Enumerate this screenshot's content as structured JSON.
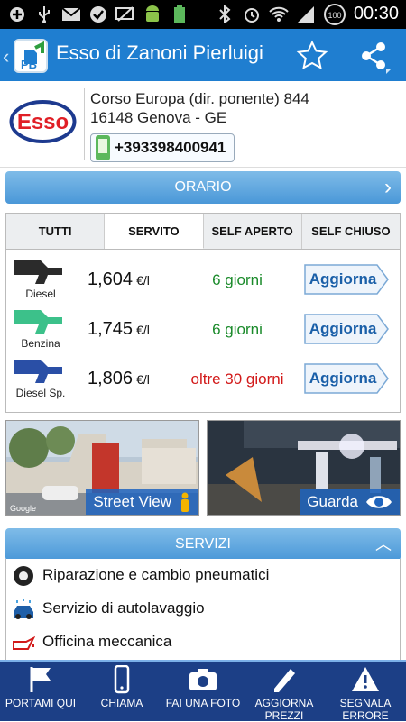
{
  "status_bar": {
    "time": "00:30",
    "battery": "100",
    "left_icons": [
      "plus-icon",
      "usb-icon",
      "gmail-icon",
      "check-icon",
      "mail-off-icon",
      "android-icon",
      "battery-small-icon"
    ],
    "right_icons": [
      "bluetooth-icon",
      "alarm-icon",
      "wifi-icon",
      "signal-icon",
      "battery-icon"
    ]
  },
  "app_bar": {
    "title": "Esso di Zanoni Pierluigi",
    "icons": [
      "back-icon",
      "app-logo-icon",
      "star-icon",
      "share-icon"
    ]
  },
  "station": {
    "brand": "Esso",
    "address_line1": "Corso Europa (dir. ponente) 844",
    "address_line2": "16148 Genova - GE",
    "phone": "+393398400941"
  },
  "orario": {
    "label": "ORARIO"
  },
  "price_tabs": [
    "TUTTI",
    "SERVITO",
    "SELF APERTO",
    "SELF CHIUSO"
  ],
  "active_tab": "SERVITO",
  "prices": [
    {
      "fuel": "Diesel",
      "price": "1,604",
      "unit": "€/l",
      "age": "6 giorni",
      "age_color": "#1a8a2a",
      "pump_color": "#2b2b2b",
      "button": "Aggiorna"
    },
    {
      "fuel": "Benzina",
      "price": "1,745",
      "unit": "€/l",
      "age": "6 giorni",
      "age_color": "#1a8a2a",
      "pump_color": "#3cc18a",
      "button": "Aggiorna"
    },
    {
      "fuel": "Diesel Sp.",
      "price": "1,806",
      "unit": "€/l",
      "age": "oltre 30 giorni",
      "age_color": "#d21a1a",
      "pump_color": "#2a4fa6",
      "button": "Aggiorna"
    }
  ],
  "photos": {
    "street_view": {
      "label": "Street View",
      "watermark": "Google"
    },
    "guarda": {
      "label": "Guarda"
    }
  },
  "servizi": {
    "label": "SERVIZI",
    "items": [
      {
        "label": "Riparazione e cambio pneumatici",
        "icon": "tire-icon"
      },
      {
        "label": "Servizio di autolavaggio",
        "icon": "car-wash-icon"
      },
      {
        "label": "Officina meccanica",
        "icon": "oil-can-icon"
      }
    ]
  },
  "bottom_bar": [
    {
      "label": "PORTAMI QUI",
      "icon": "flag-icon"
    },
    {
      "label": "CHIAMA",
      "icon": "phone-icon"
    },
    {
      "label": "FAI UNA FOTO",
      "icon": "camera-icon"
    },
    {
      "label": "AGGIORNA PREZZI",
      "icon": "pencil-icon"
    },
    {
      "label": "SEGNALA ERRORE",
      "icon": "warning-icon"
    }
  ],
  "colors": {
    "app_bar": "#1f7ed0",
    "bottom_bar": "#1c3f86",
    "accent": "#4a98d8"
  }
}
